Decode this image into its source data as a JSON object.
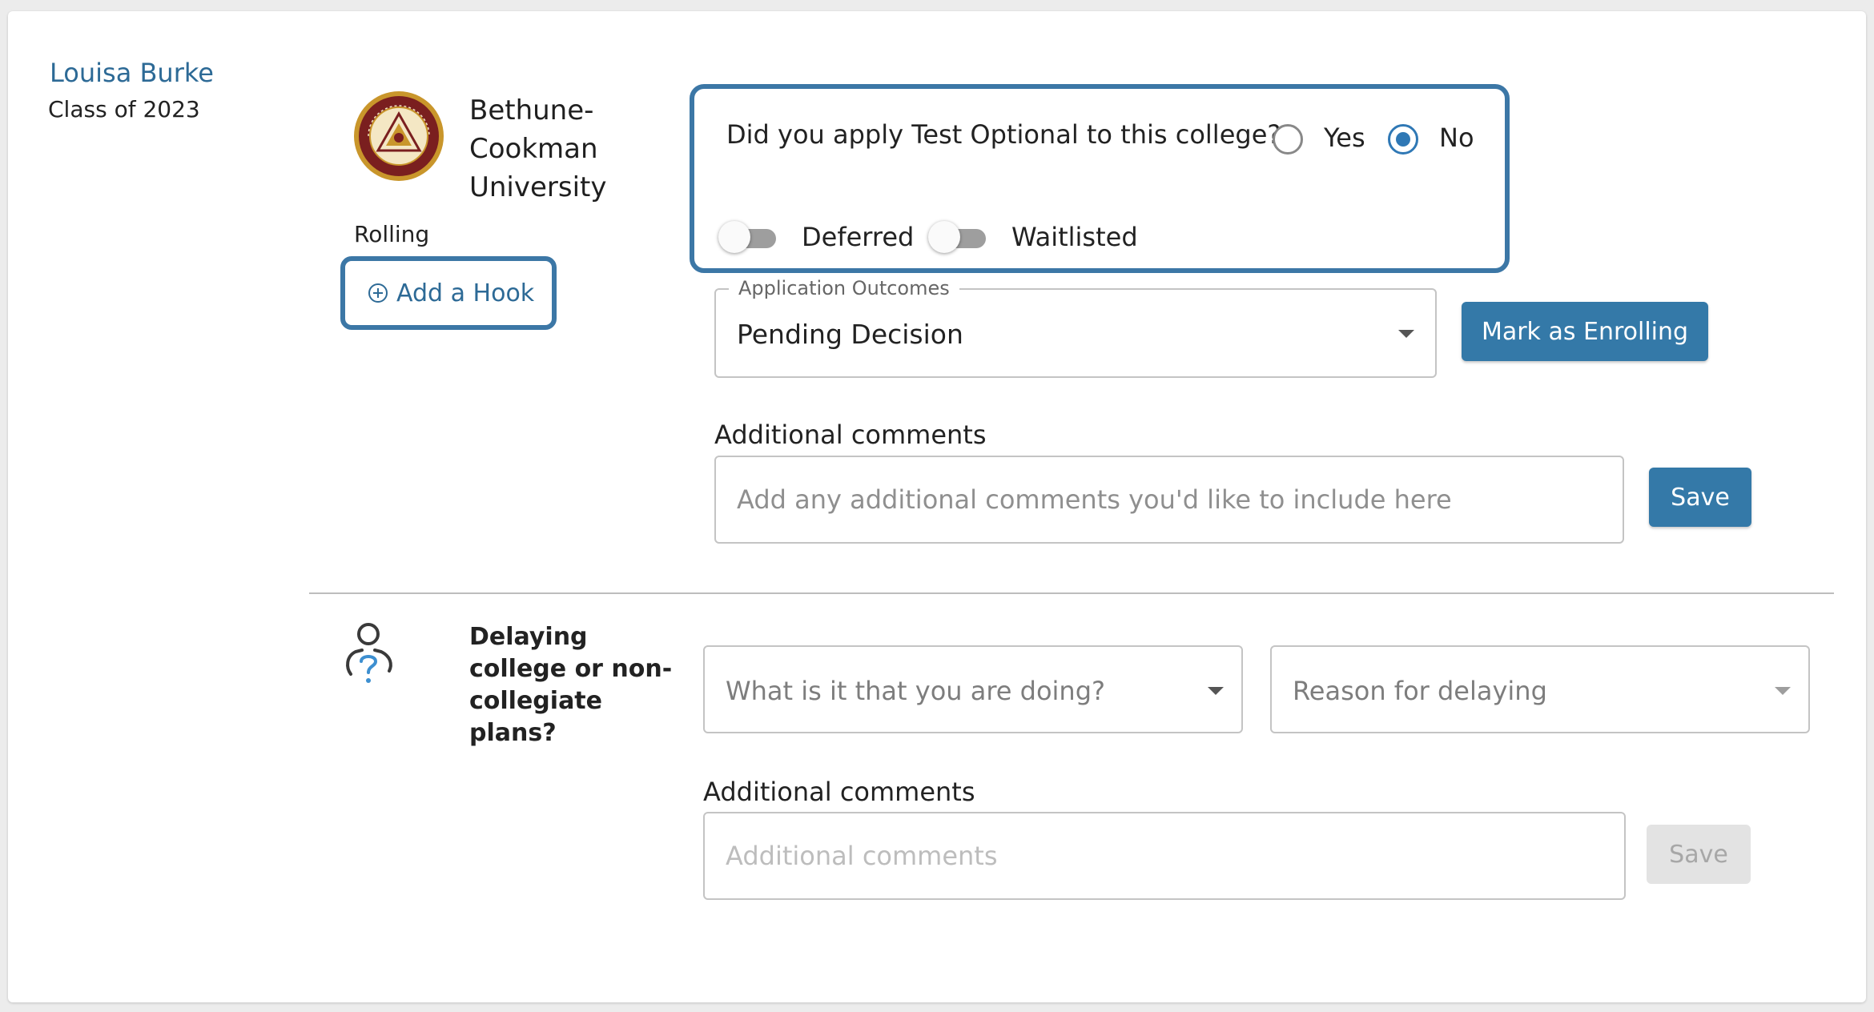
{
  "student": {
    "name": "Louisa Burke",
    "class_of": "Class of 2023"
  },
  "college": {
    "name": "Bethune-Cookman University",
    "deadline_type": "Rolling",
    "seal_text": "BETHUNE-COOKMAN UNIVERSITY 1923 HEAD 1872 2007"
  },
  "hook": {
    "label": "Add a Hook"
  },
  "test_optional": {
    "question": "Did you apply Test Optional to this college?",
    "options": [
      "Yes",
      "No"
    ],
    "selected": "No"
  },
  "toggles": {
    "deferred": {
      "label": "Deferred",
      "on": false
    },
    "waitlisted": {
      "label": "Waitlisted",
      "on": false
    }
  },
  "outcomes": {
    "legend": "Application Outcomes",
    "value": "Pending Decision"
  },
  "enroll_button": "Mark as Enrolling",
  "comments_college": {
    "label": "Additional comments",
    "placeholder": "Add any additional comments you'd like to include here",
    "save": "Save"
  },
  "delay": {
    "label": "Delaying college or non-collegiate plans?",
    "doing_placeholder": "What is it that you are doing?",
    "reason_placeholder": "Reason for delaying",
    "comments_label": "Additional comments",
    "comments_placeholder": "Additional comments",
    "save": "Save"
  },
  "colors": {
    "accent": "#3479a8",
    "focus_outline": "#3c77a6",
    "link": "#2d6a96",
    "seal_gold": "#c9962b",
    "seal_maroon": "#7a1f1f"
  }
}
